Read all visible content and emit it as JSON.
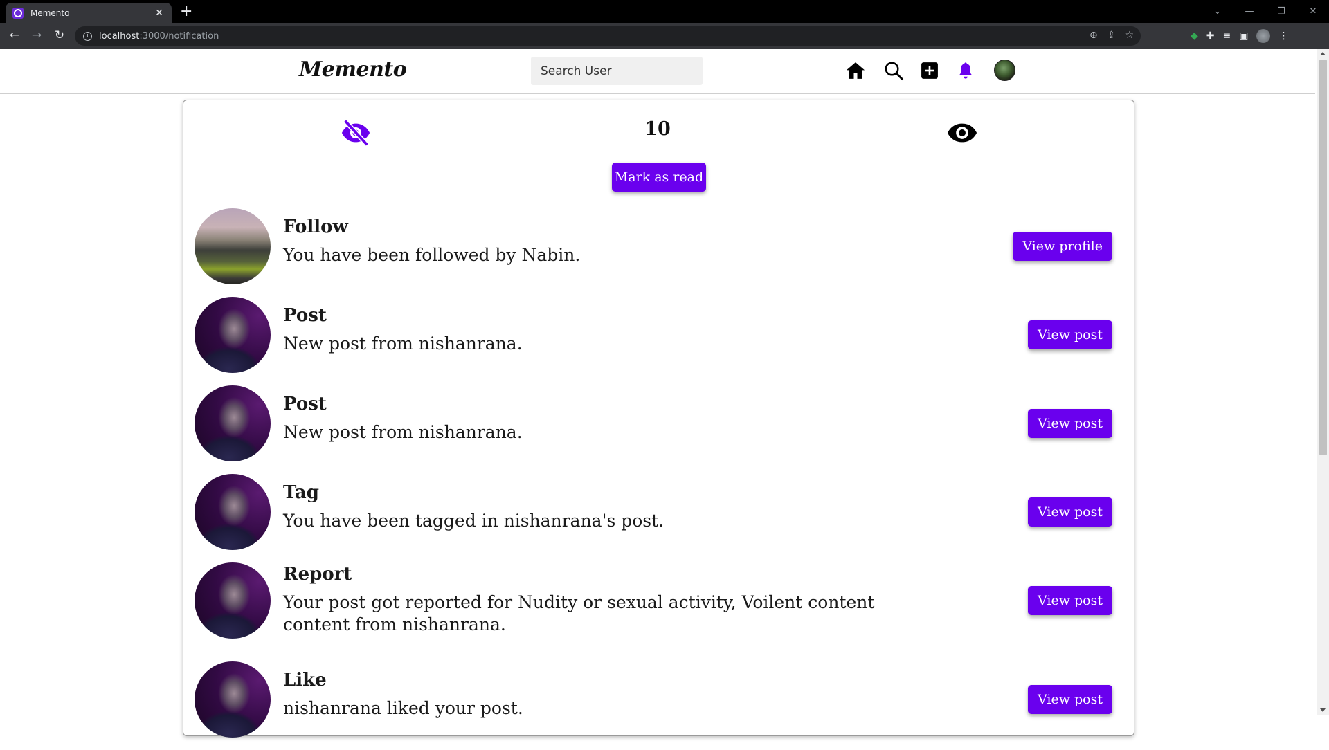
{
  "browser": {
    "tab_title": "Memento",
    "url_host": "localhost",
    "url_path": ":3000/notification"
  },
  "header": {
    "logo": "Memento",
    "search_placeholder": "Search User"
  },
  "notifications_panel": {
    "count": "10",
    "mark_as_read_label": "Mark as read",
    "accent_color": "#6a00ee",
    "items": [
      {
        "title": "Follow",
        "message": "You have been followed by Nabin.",
        "button": "View profile",
        "avatar": "landscape"
      },
      {
        "title": "Post",
        "message": "New post from nishanrana.",
        "button": "View post",
        "avatar": "portrait"
      },
      {
        "title": "Post",
        "message": "New post from nishanrana.",
        "button": "View post",
        "avatar": "portrait"
      },
      {
        "title": "Tag",
        "message": "You have been tagged in nishanrana's post.",
        "button": "View post",
        "avatar": "portrait"
      },
      {
        "title": "Report",
        "message": "Your post got reported for Nudity or sexual activity, Voilent content content from nishanrana.",
        "button": "View post",
        "avatar": "portrait"
      },
      {
        "title": "Like",
        "message": "nishanrana liked your post.",
        "button": "View post",
        "avatar": "portrait"
      }
    ]
  }
}
